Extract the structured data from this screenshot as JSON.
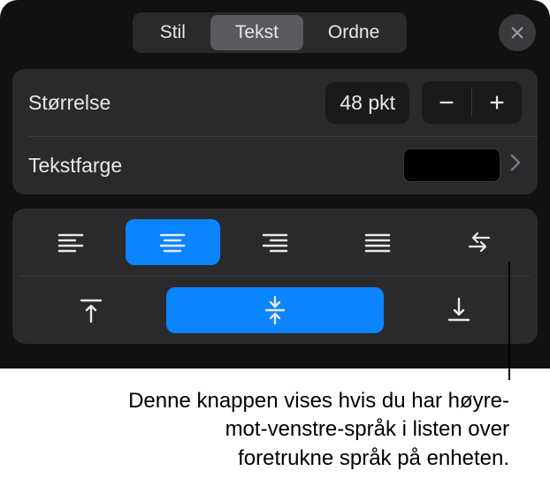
{
  "tabs": {
    "style": "Stil",
    "text": "Tekst",
    "arrange": "Ordne"
  },
  "size": {
    "label": "Størrelse",
    "value": "48 pkt"
  },
  "textcolor": {
    "label": "Tekstfarge",
    "value": "#000000"
  },
  "callout": "Denne knappen vises hvis du har høyre-mot-venstre-språk i listen over foretrukne språk på enheten."
}
